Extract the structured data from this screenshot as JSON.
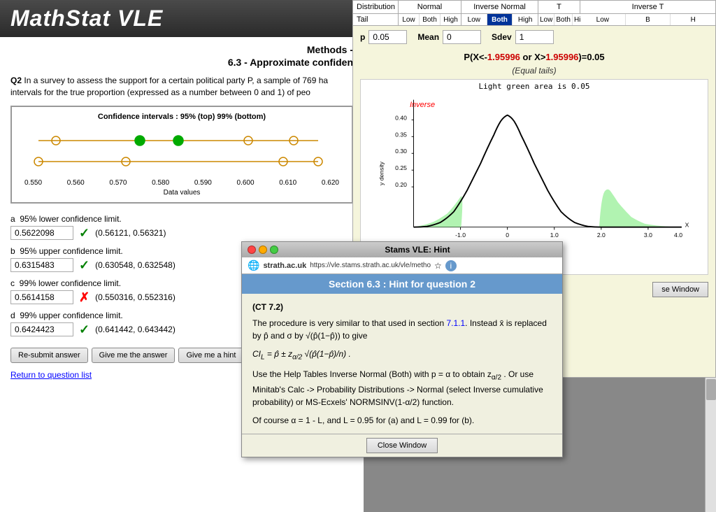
{
  "app": {
    "title": "MathStat VLE"
  },
  "left": {
    "methods_title": "Methods -",
    "methods_subtitle": "6.3 - Approximate confiden",
    "question_label": "Q2",
    "question_text": "In a survey to assess the support for a certain political party P, a sample of 769 ha intervals for the true proportion (expressed as a number between 0 and 1) of peo",
    "ci_chart_title": "Confidence intervals : 95% (top) 99% (bottom)",
    "ci_axis_values": [
      "0.550",
      "0.560",
      "0.570",
      "0.580",
      "0.590",
      "0.600",
      "0.610",
      "0.620"
    ],
    "ci_x_label": "Data values",
    "answers": [
      {
        "label": "a  95% lower confidence limit.",
        "value": "0.5622098",
        "status": "correct",
        "interval": "(0.56121, 0.56321)"
      },
      {
        "label": "b  95% upper confidence limit.",
        "value": "0.6315483",
        "status": "correct",
        "interval": "(0.630548, 0.632548)"
      },
      {
        "label": "c  99% lower confidence limit.",
        "value": "0.5614158",
        "status": "incorrect",
        "interval": "(0.550316, 0.552316)"
      },
      {
        "label": "d  99% upper confidence limit.",
        "value": "0.6424423",
        "status": "correct",
        "interval": "(0.641442, 0.643442)"
      }
    ],
    "buttons": {
      "resubmit": "Re-submit answer",
      "give_answer": "Give me the answer",
      "give_hint": "Give me a hint"
    },
    "return_link": "Return to question list"
  },
  "right": {
    "distributions": [
      {
        "name": "Normal",
        "tails": [
          "Low",
          "Both",
          "High"
        ]
      },
      {
        "name": "Inverse Normal",
        "tails": [
          "Low",
          "Both",
          "High"
        ]
      },
      {
        "name": "T",
        "tails": [
          "Low",
          "Both",
          "High"
        ]
      },
      {
        "name": "Inverse T",
        "tails": [
          "Low",
          "B",
          "H"
        ]
      }
    ],
    "active_dist": "Normal",
    "active_tail": "Both",
    "params": {
      "p_label": "p",
      "p_value": "0.05",
      "mean_label": "Mean",
      "mean_value": "0",
      "sdev_label": "Sdev",
      "sdev_value": "1"
    },
    "formula": "P(X<-1.95996 or X>1.95996)=0.05",
    "formula_highlight": "1.95996",
    "subtitle": "(Equal tails)",
    "chart_title": "Light green area is 0.05",
    "inverse_label": "Inverse",
    "y_axis_label": "y density",
    "x_axis_label": "X",
    "x_axis_values": [
      "-1.0",
      "0",
      "1.0",
      "2.0",
      "3.0",
      "4.0"
    ],
    "y_axis_values": [
      "0.40",
      "0.35",
      "0.30",
      "0.25",
      "0.20"
    ],
    "close_window": "se Window"
  },
  "hint": {
    "title": "Stams VLE: Hint",
    "site": "strath.ac.uk",
    "url": "https://vle.stams.strath.ac.uk/vle/metho",
    "header": "Section 6.3 : Hint for question 2",
    "body_ct": "(CT 7.2)",
    "body_p1": "The procedure is very similar to that used in section 7.1.1. Instead x̄ is replaced by p̂ and σ by √(p̂(1−p̂)) to give",
    "formula_ci": "CI_L = p̂ ± z_{α/2} √(p̂(1−p̂)/n) .",
    "body_p2": "Use the Help Tables Inverse Normal (Both) with p = α to obtain z_{α/2} . Or use Minitab's Calc -> Probability Distributions -> Normal (select Inverse cumulative probability) or MS-Ecxels' NORMSINV(1-α/2) function.",
    "body_p3": "Of course α = 1 - L, and L = 0.95 for (a) and L = 0.99 for (b).",
    "close_button": "Close Window"
  }
}
